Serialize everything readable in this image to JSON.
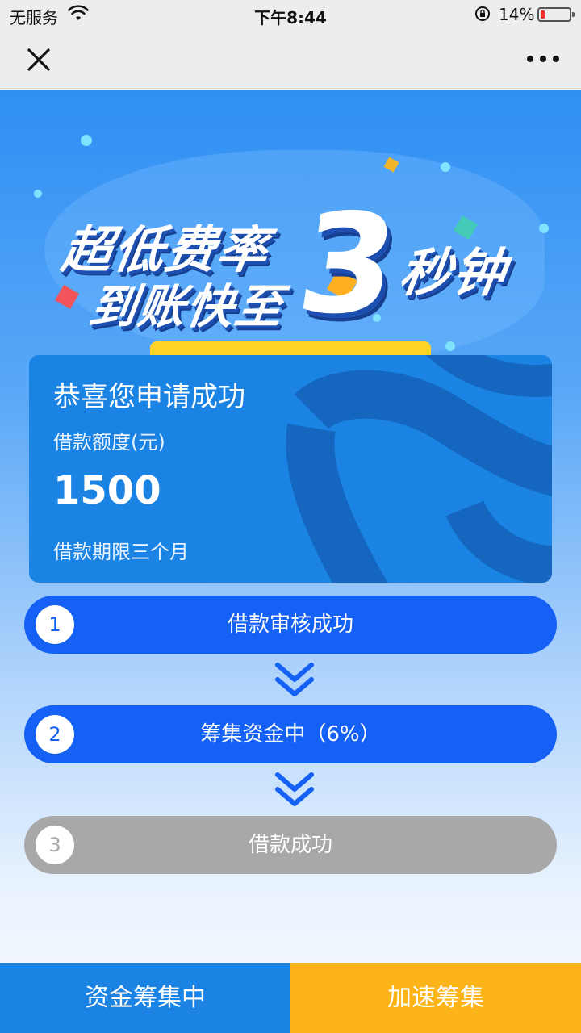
{
  "status_bar": {
    "carrier": "无服务",
    "time": "下午8:44",
    "battery_percent": "14%",
    "battery_level": 0.14,
    "icons": [
      "wifi-icon",
      "orientation-lock-icon",
      "battery-icon"
    ]
  },
  "nav": {
    "icons": [
      "close-icon",
      "more-icon"
    ]
  },
  "banner": {
    "line1": "超低费率",
    "line2": "到账快至",
    "number": "3",
    "line3": "秒钟"
  },
  "loan_card": {
    "title": "恭喜您申请成功",
    "amount_label": "借款额度(元)",
    "amount": "1500",
    "term": "借款期限三个月"
  },
  "steps": [
    {
      "number": "1",
      "label": "借款审核成功",
      "status": "active"
    },
    {
      "number": "2",
      "label": "筹集资金中（6%）",
      "status": "active"
    },
    {
      "number": "3",
      "label": "借款成功",
      "status": "pending"
    }
  ],
  "bottom": {
    "left_label": "资金筹集中",
    "right_label": "加速筹集"
  },
  "colors": {
    "primary_blue": "#1561f5",
    "card_blue": "#1a83e3",
    "accent_yellow": "#fdb419",
    "pending_gray": "#a8a8a8"
  }
}
